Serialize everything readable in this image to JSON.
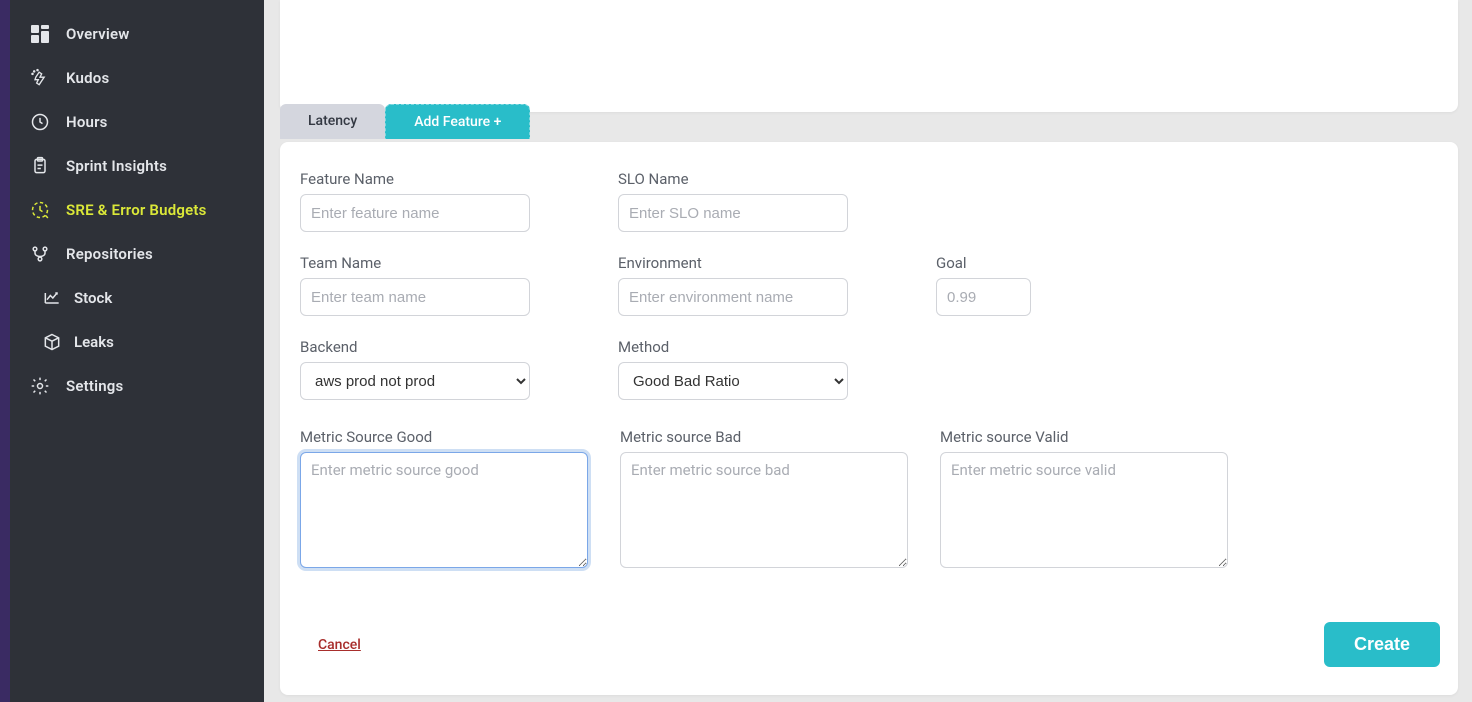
{
  "sidebar": {
    "items": [
      {
        "label": "Overview",
        "icon": "dashboard-icon"
      },
      {
        "label": "Kudos",
        "icon": "clap-icon"
      },
      {
        "label": "Hours",
        "icon": "clock-icon"
      },
      {
        "label": "Sprint Insights",
        "icon": "clipboard-icon"
      },
      {
        "label": "SRE & Error Budgets",
        "icon": "budget-icon",
        "active": true
      },
      {
        "label": "Repositories",
        "icon": "branch-icon"
      }
    ],
    "subitems": [
      {
        "label": "Stock",
        "icon": "chart-icon"
      },
      {
        "label": "Leaks",
        "icon": "box-icon"
      }
    ],
    "footer": {
      "label": "Settings",
      "icon": "gear-icon"
    }
  },
  "tabs": {
    "inactive": "Latency",
    "active": "Add Feature +"
  },
  "form": {
    "feature_name": {
      "label": "Feature Name",
      "placeholder": "Enter feature name",
      "value": ""
    },
    "slo_name": {
      "label": "SLO Name",
      "placeholder": "Enter SLO name",
      "value": ""
    },
    "team_name": {
      "label": "Team Name",
      "placeholder": "Enter team name",
      "value": ""
    },
    "environment": {
      "label": "Environment",
      "placeholder": "Enter environment name",
      "value": ""
    },
    "goal": {
      "label": "Goal",
      "placeholder": "0.99",
      "value": ""
    },
    "backend": {
      "label": "Backend",
      "selected": "aws prod not prod"
    },
    "method": {
      "label": "Method",
      "selected": "Good Bad Ratio"
    },
    "metric_good": {
      "label": "Metric Source Good",
      "placeholder": "Enter metric source good",
      "value": ""
    },
    "metric_bad": {
      "label": "Metric source Bad",
      "placeholder": "Enter metric source bad",
      "value": ""
    },
    "metric_valid": {
      "label": "Metric source Valid",
      "placeholder": "Enter metric source valid",
      "value": ""
    }
  },
  "actions": {
    "cancel": "Cancel",
    "create": "Create"
  }
}
